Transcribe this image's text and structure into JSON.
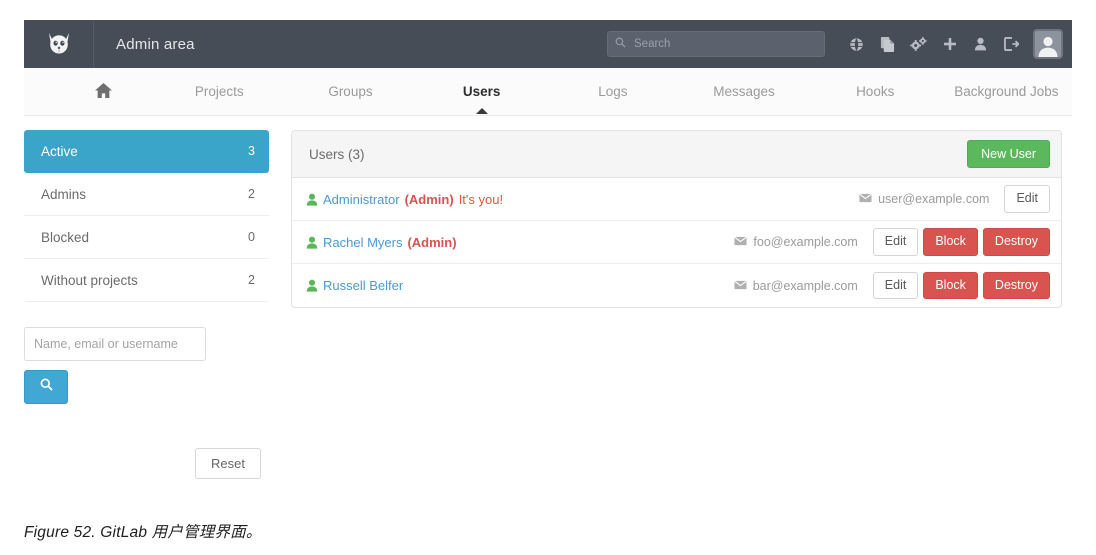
{
  "navbar": {
    "logo_icon": "gitlab-fox-logo",
    "app_title": "Admin area",
    "search": {
      "placeholder": "Search",
      "value": "",
      "icon": "search-icon"
    },
    "icons": [
      {
        "name": "globe-icon",
        "label": "Public area"
      },
      {
        "name": "copy-files-icon",
        "label": "Snippets"
      },
      {
        "name": "gears-icon",
        "label": "Admin settings"
      },
      {
        "name": "plus-icon",
        "label": "New"
      },
      {
        "name": "user-icon",
        "label": "Profile"
      },
      {
        "name": "sign-out-icon",
        "label": "Sign out"
      }
    ],
    "avatar_icon": "avatar-placeholder"
  },
  "tabs": [
    {
      "label": "",
      "icon": "home-icon",
      "active": false
    },
    {
      "label": "Projects",
      "active": false
    },
    {
      "label": "Groups",
      "active": false
    },
    {
      "label": "Users",
      "active": true
    },
    {
      "label": "Logs",
      "active": false
    },
    {
      "label": "Messages",
      "active": false
    },
    {
      "label": "Hooks",
      "active": false
    },
    {
      "label": "Background Jobs",
      "active": false
    }
  ],
  "sidebar": {
    "filters": [
      {
        "label": "Active",
        "count": "3",
        "active": true
      },
      {
        "label": "Admins",
        "count": "2",
        "active": false
      },
      {
        "label": "Blocked",
        "count": "0",
        "active": false
      },
      {
        "label": "Without projects",
        "count": "2",
        "active": false
      }
    ],
    "search_field": {
      "placeholder": "Name, email or username",
      "value": ""
    },
    "search_button_icon": "search-icon",
    "reset_label": "Reset"
  },
  "panel": {
    "title": "Users (3)",
    "new_user_label": "New User",
    "rows": [
      {
        "user_icon": "user-icon",
        "name": "Administrator",
        "badge": "(Admin)",
        "note": "It's you!",
        "mail_icon": "envelope-icon",
        "email": "user@example.com",
        "actions": [
          {
            "label": "Edit",
            "style": "default"
          }
        ]
      },
      {
        "user_icon": "user-icon",
        "name": "Rachel Myers",
        "badge": "(Admin)",
        "note": "",
        "mail_icon": "envelope-icon",
        "email": "foo@example.com",
        "actions": [
          {
            "label": "Edit",
            "style": "default"
          },
          {
            "label": "Block",
            "style": "danger"
          },
          {
            "label": "Destroy",
            "style": "danger"
          }
        ]
      },
      {
        "user_icon": "user-icon",
        "name": "Russell Belfer",
        "badge": "",
        "note": "",
        "mail_icon": "envelope-icon",
        "email": "bar@example.com",
        "actions": [
          {
            "label": "Edit",
            "style": "default"
          },
          {
            "label": "Block",
            "style": "danger"
          },
          {
            "label": "Destroy",
            "style": "danger"
          }
        ]
      }
    ]
  },
  "caption": "Figure 52. GitLab 用户管理界面。",
  "colors": {
    "navbar_bg": "#474d57",
    "active_filter": "#3aa4c9",
    "new_user_green": "#5cb85c",
    "danger_red": "#d9534f",
    "link_blue": "#4a9ad4",
    "user_icon_green": "#5bb75b"
  }
}
